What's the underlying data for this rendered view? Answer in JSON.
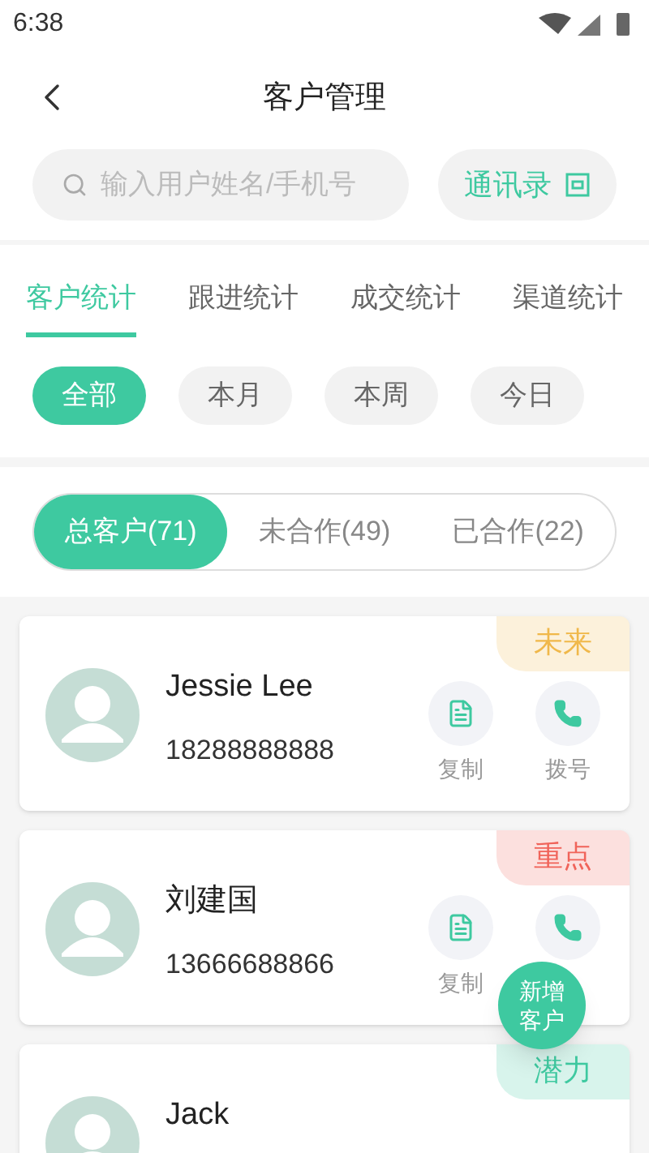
{
  "status_bar": {
    "time": "6:38"
  },
  "header": {
    "title": "客户管理"
  },
  "search": {
    "placeholder": "输入用户姓名/手机号"
  },
  "contacts_button": {
    "label": "通讯录"
  },
  "tabs": [
    {
      "label": "客户统计",
      "selected": true
    },
    {
      "label": "跟进统计",
      "selected": false
    },
    {
      "label": "成交统计",
      "selected": false
    },
    {
      "label": "渠道统计",
      "selected": false
    }
  ],
  "period_filters": [
    {
      "label": "全部",
      "selected": true
    },
    {
      "label": "本月",
      "selected": false
    },
    {
      "label": "本周",
      "selected": false
    },
    {
      "label": "今日",
      "selected": false
    }
  ],
  "segments": [
    {
      "label": "总客户(71)",
      "selected": true
    },
    {
      "label": "未合作(49)",
      "selected": false
    },
    {
      "label": "已合作(22)",
      "selected": false
    }
  ],
  "customers": [
    {
      "name": "Jessie Lee",
      "phone": "18288888888",
      "tag": {
        "label": "未来",
        "color": "#f0b84a"
      },
      "actions": [
        {
          "kind": "copy",
          "label": "复制"
        },
        {
          "kind": "dial",
          "label": "拨号"
        }
      ]
    },
    {
      "name": "刘建国",
      "phone": "13666688866",
      "tag": {
        "label": "重点",
        "color": "#f0645a"
      },
      "actions": [
        {
          "kind": "copy",
          "label": "复制"
        },
        {
          "kind": "dial"
        }
      ]
    },
    {
      "name": "Jack",
      "tag": {
        "label": "潜力",
        "color": "#3ec9a0"
      }
    }
  ],
  "fab": {
    "label": "新增客户"
  }
}
